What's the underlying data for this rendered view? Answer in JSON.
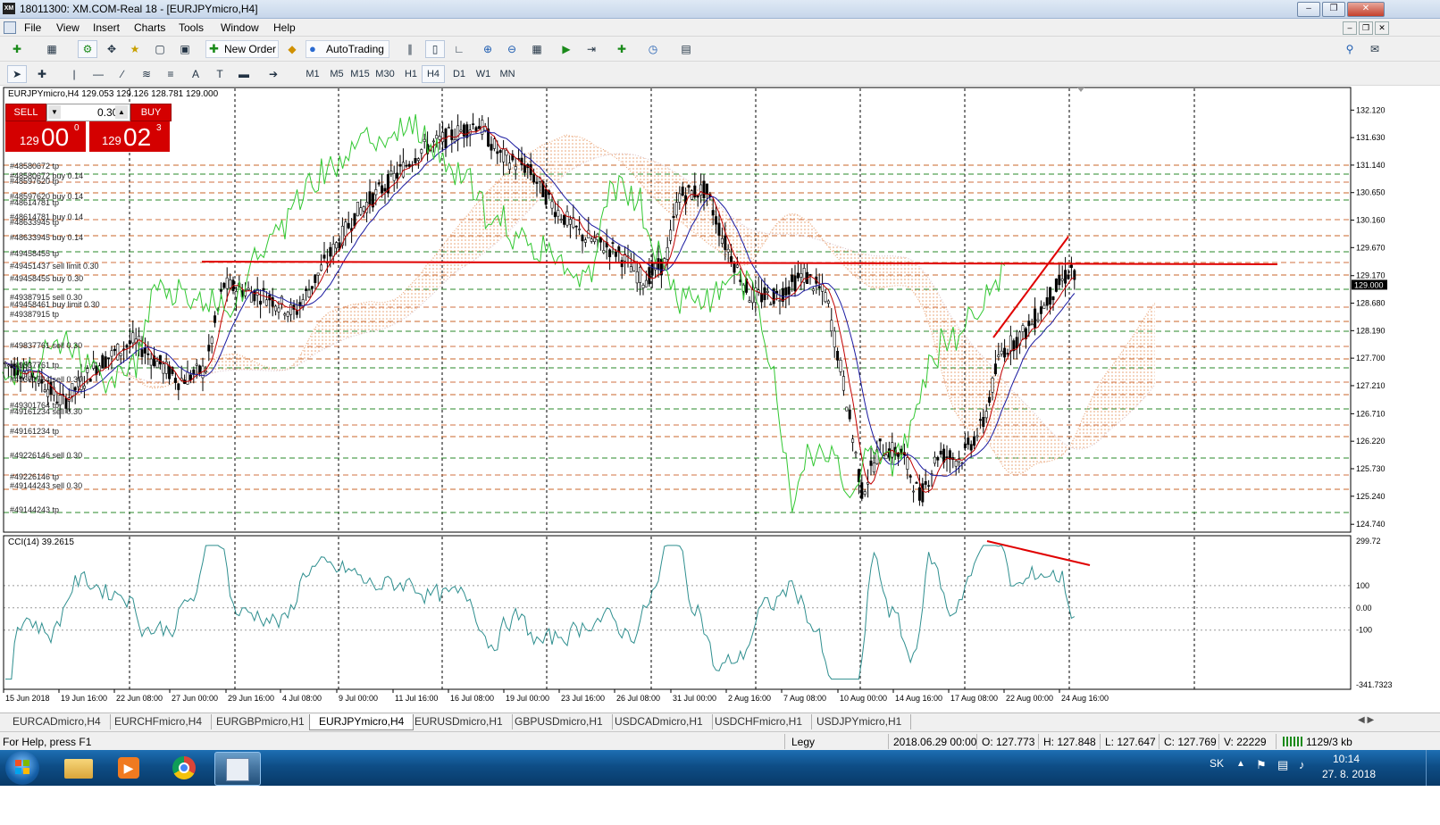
{
  "window": {
    "title": "18011300: XM.COM-Real 18 - [EURJPYmicro,H4]",
    "app_icon_text": "XM"
  },
  "menu": [
    "File",
    "View",
    "Insert",
    "Charts",
    "Tools",
    "Window",
    "Help"
  ],
  "toolbar": {
    "new_order": "New Order",
    "autotrading": "AutoTrading"
  },
  "timeframes": [
    "M1",
    "M5",
    "M15",
    "M30",
    "H1",
    "H4",
    "D1",
    "W1",
    "MN"
  ],
  "active_timeframe": "H4",
  "chart": {
    "header": "EURJPYmicro,H4  129.053 129.126 128.781 129.000",
    "indicator_label": "CCI(14) 39.2615",
    "current_price_label": "129.000",
    "price_axis": [
      "132.120",
      "131.630",
      "131.140",
      "130.650",
      "130.160",
      "129.670",
      "129.170",
      "128.680",
      "128.190",
      "127.700",
      "127.210",
      "126.710",
      "126.220",
      "125.730",
      "125.240",
      "124.740"
    ],
    "cci_axis": [
      "299.72",
      "100",
      "0.00",
      "-100",
      "-341.7323"
    ],
    "time_axis": [
      "15 Jun 2018",
      "19 Jun 16:00",
      "22 Jun 08:00",
      "27 Jun 00:00",
      "29 Jun 16:00",
      "4 Jul 08:00",
      "9 Jul 00:00",
      "11 Jul 16:00",
      "16 Jul 08:00",
      "19 Jul 00:00",
      "23 Jul 16:00",
      "26 Jul 08:00",
      "31 Jul 00:00",
      "2 Aug 16:00",
      "7 Aug 08:00",
      "10 Aug 00:00",
      "14 Aug 16:00",
      "17 Aug 08:00",
      "22 Aug 00:00",
      "24 Aug 16:00"
    ],
    "order_labels": [
      "#48580672 tp",
      "#48580672 buy 0.14",
      "#48597620 tp",
      "#48597620 buy 0.14",
      "#48614781 tp",
      "#48614781 buy 0.14",
      "#48633945 tp",
      "#48633945 buy 0.14",
      "#49458455 tp",
      "#49451437 sell limit 0.30",
      "#49458455 buy 0.30",
      "#49387915 sell 0.30",
      "#49458461 buy limit 0.30",
      "#49387915 tp",
      "#49837761 sell 0.30",
      "#49837761 tp",
      "#49301764 sell 0.30",
      "#49301764 tp",
      "#49161234 sell 0.30",
      "#49161234 tp",
      "#49226146 sell 0.30",
      "#49226146 tp",
      "#49144243 sell 0.30",
      "#49144243 tp"
    ]
  },
  "trade_panel": {
    "sell_label": "SELL",
    "buy_label": "BUY",
    "lot": "0.30",
    "sell_prefix": "129",
    "sell_big": "00",
    "sell_sup": "0",
    "buy_prefix": "129",
    "buy_big": "02",
    "buy_sup": "3"
  },
  "tabs": [
    "EURCADmicro,H4",
    "EURCHFmicro,H4",
    "EURGBPmicro,H1",
    "EURJPYmicro,H4",
    "EURUSDmicro,H1",
    "GBPUSDmicro,H1",
    "USDCADmicro,H1",
    "USDCHFmicro,H1",
    "USDJPYmicro,H1"
  ],
  "active_tab": "EURJPYmicro,H4",
  "status": {
    "help": "For Help, press F1",
    "profile": "Legy",
    "datetime": "2018.06.29 00:00",
    "open": "O: 127.773",
    "high": "H: 127.848",
    "low": "L: 127.647",
    "close": "C: 127.769",
    "volume": "V: 22229",
    "traffic": "1129/3 kb"
  },
  "taskbar": {
    "lang": "SK",
    "time": "10:14",
    "date": "27. 8. 2018"
  },
  "colors": {
    "sell_buy_red": "#d40000",
    "tenkan": "#c00000",
    "kijun": "#1a1aa0",
    "chikou": "#32c832",
    "cci": "#2f8f8f",
    "cloud_up": "#e8a070",
    "cloud_down": "#d8c0c8",
    "trend_red": "#e00000"
  }
}
